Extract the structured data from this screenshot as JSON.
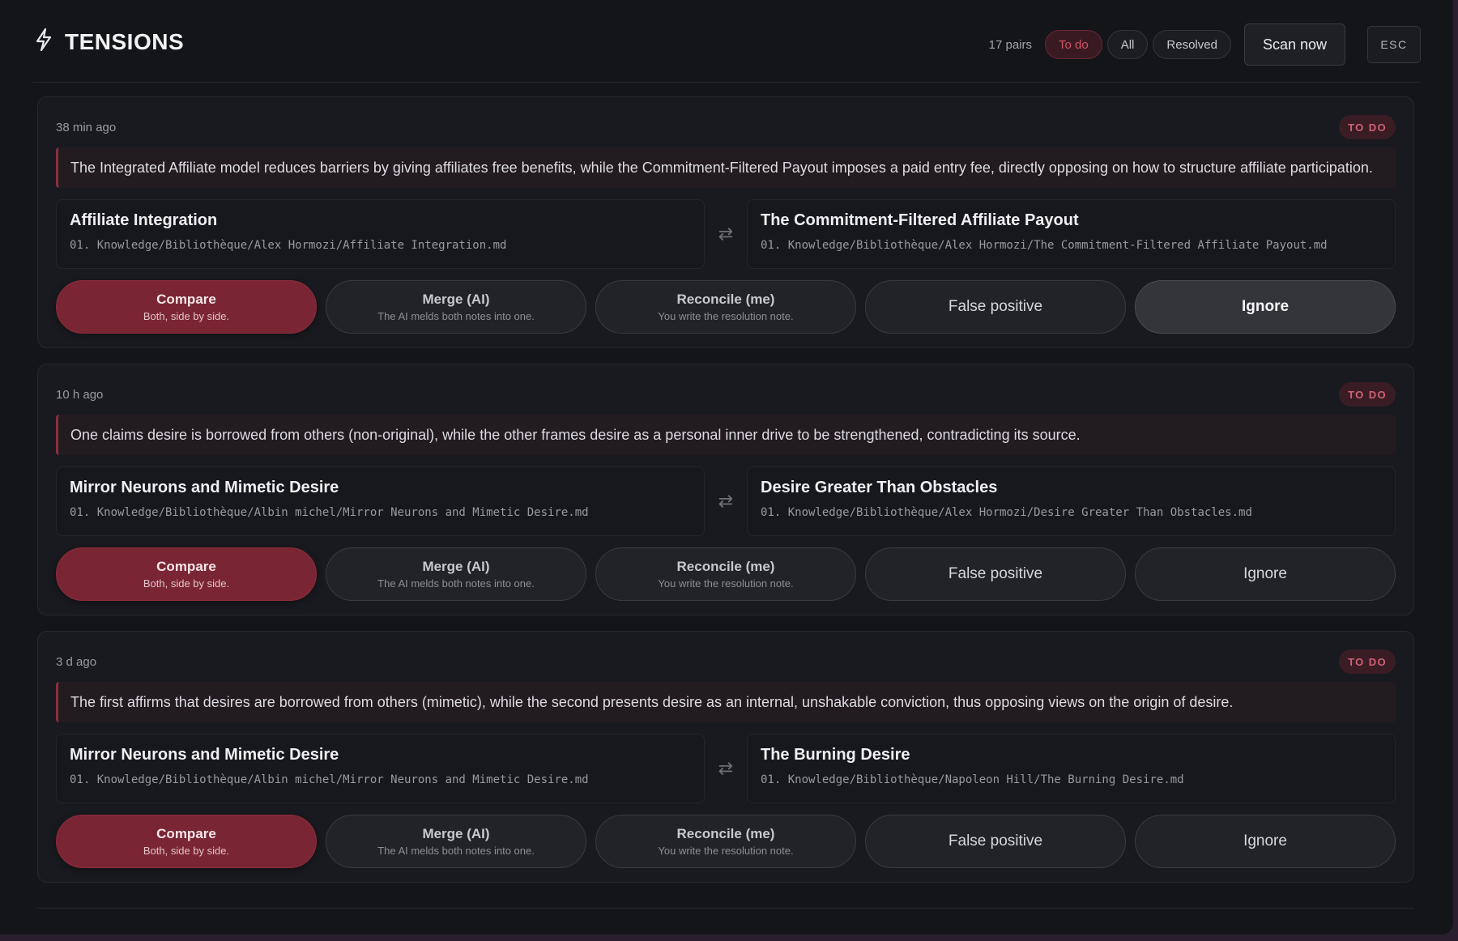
{
  "header": {
    "title": "TENSIONS",
    "pairs": "17 pairs",
    "filters": [
      "To do",
      "All",
      "Resolved"
    ],
    "active_filter": "To do",
    "scan_label": "Scan now",
    "esc_label": "ESC"
  },
  "actions_common": {
    "compare": "Compare",
    "compare_sub": "Both, side by side.",
    "merge": "Merge (AI)",
    "merge_sub": "The AI melds both notes into one.",
    "reconcile": "Reconcile (me)",
    "reconcile_sub": "You write the resolution note.",
    "false_positive": "False positive",
    "ignore": "Ignore"
  },
  "cards": [
    {
      "time": "38 min ago",
      "status": "TO DO",
      "reason": "The Integrated Affiliate model reduces barriers by giving affiliates free benefits, while the Commitment-Filtered Payout imposes a paid entry fee, directly opposing on how to structure affiliate participation.",
      "left": {
        "title": "Affiliate Integration",
        "path": "01. Knowledge/Bibliothèque/Alex Hormozi/Affiliate Integration.md"
      },
      "right": {
        "title": "The Commitment-Filtered Affiliate Payout",
        "path": "01. Knowledge/Bibliothèque/Alex Hormozi/The Commitment-Filtered Affiliate Payout.md"
      },
      "ignore_highlighted": true
    },
    {
      "time": "10 h ago",
      "status": "TO DO",
      "reason": "One claims desire is borrowed from others (non-original), while the other frames desire as a personal inner drive to be strengthened, contradicting its source.",
      "left": {
        "title": "Mirror Neurons and Mimetic Desire",
        "path": "01. Knowledge/Bibliothèque/Albin michel/Mirror Neurons and Mimetic Desire.md"
      },
      "right": {
        "title": "Desire Greater Than Obstacles",
        "path": "01. Knowledge/Bibliothèque/Alex Hormozi/Desire Greater Than Obstacles.md"
      },
      "ignore_highlighted": false
    },
    {
      "time": "3 d ago",
      "status": "TO DO",
      "reason": "The first affirms that desires are borrowed from others (mimetic), while the second presents desire as an internal, unshakable conviction, thus opposing views on the origin of desire.",
      "left": {
        "title": "Mirror Neurons and Mimetic Desire",
        "path": "01. Knowledge/Bibliothèque/Albin michel/Mirror Neurons and Mimetic Desire.md"
      },
      "right": {
        "title": "The Burning Desire",
        "path": "01. Knowledge/Bibliothèque/Napoleon Hill/The Burning Desire.md"
      },
      "ignore_highlighted": false
    }
  ],
  "swap_icon": "swap-arrows-icon",
  "colors": {
    "accent": "#7a2533",
    "badge_text": "#d06276",
    "background": "#141519"
  }
}
